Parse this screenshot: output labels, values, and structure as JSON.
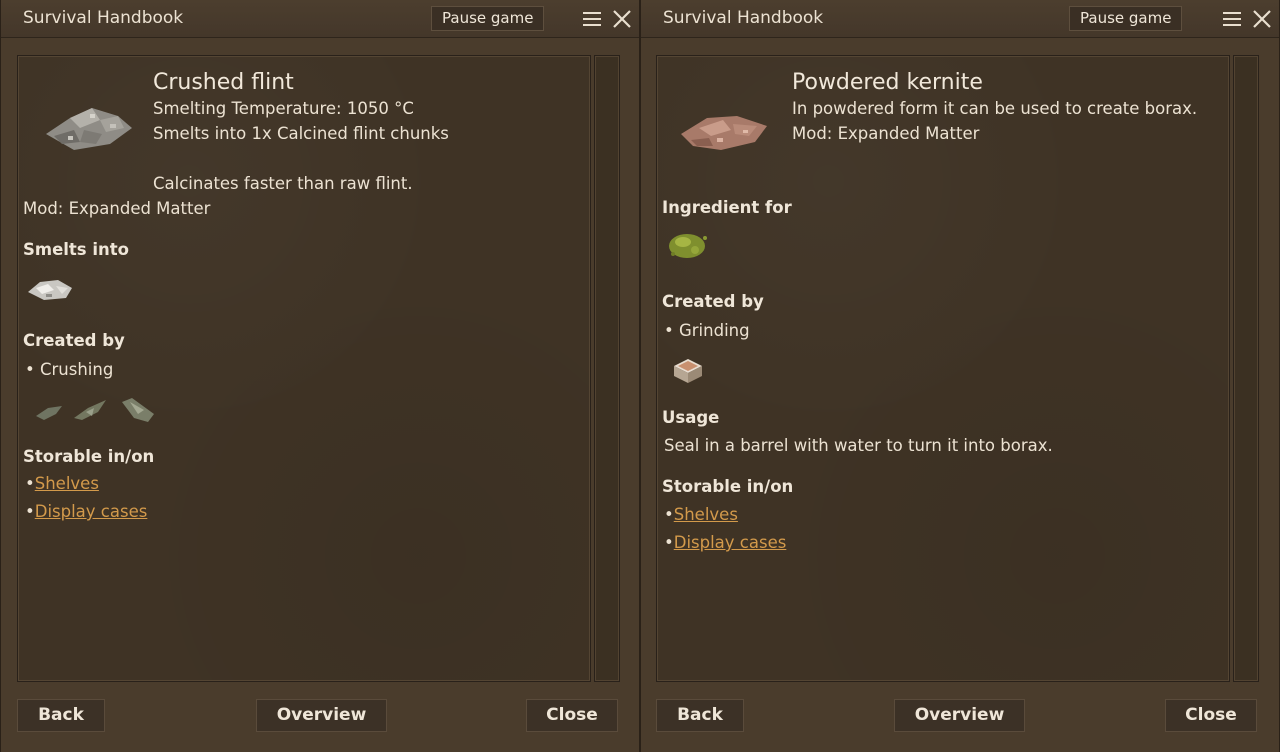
{
  "left": {
    "title": "Survival Handbook",
    "pause_label": "Pause game",
    "item_name": "Crushed flint",
    "info_lines": [
      "Smelting Temperature: 1050 °C",
      "Smelts into 1x Calcined flint chunks"
    ],
    "extra_line": "Calcinates faster than raw flint.",
    "mod_line": "Mod: Expanded Matter",
    "smelts_into_heading": "Smelts into",
    "created_by_heading": "Created by",
    "created_by_item": "Crushing",
    "storable_heading": "Storable in/on",
    "storable_links": [
      "Shelves",
      "Display cases"
    ],
    "footer": {
      "back": "Back",
      "overview": "Overview",
      "close": "Close"
    }
  },
  "right": {
    "title": "Survival Handbook",
    "pause_label": "Pause game",
    "item_name": "Powdered kernite",
    "info_lines": [
      "In powdered form it can be used to create borax.",
      "Mod: Expanded Matter"
    ],
    "ingredient_heading": "Ingredient for",
    "created_by_heading": "Created by",
    "created_by_item": "Grinding",
    "usage_heading": "Usage",
    "usage_text": "Seal in a barrel with water to turn it into borax.",
    "storable_heading": "Storable in/on",
    "storable_links": [
      "Shelves",
      "Display cases"
    ],
    "footer": {
      "back": "Back",
      "overview": "Overview",
      "close": "Close"
    }
  },
  "colors": {
    "link": "#d39a4b",
    "panel": "#3f3325",
    "text": "#ece2d2"
  },
  "icons": [
    "menu-icon",
    "close-icon",
    "crushed-flint-icon",
    "calcined-flint-icon",
    "flint-tool-icon",
    "powdered-kernite-icon",
    "green-powder-icon",
    "quern-icon"
  ]
}
